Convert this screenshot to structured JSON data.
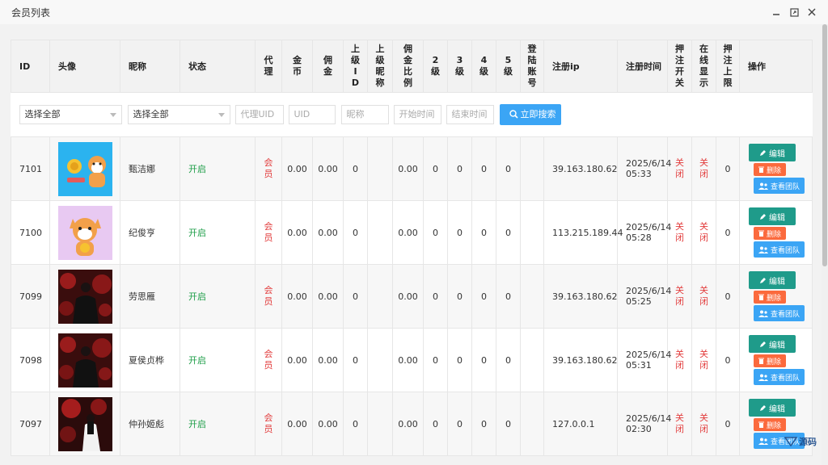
{
  "window": {
    "title": "会员列表"
  },
  "table": {
    "headers": {
      "id": "ID",
      "avatar": "头像",
      "nickname": "昵称",
      "status": "状态",
      "agent": "代理",
      "coins": "金币",
      "commission": "佣金",
      "parent_id": "上级ID",
      "parent_nick": "上级昵称",
      "comm_ratio": "佣金比例",
      "lv2": "2级",
      "lv3": "3级",
      "lv4": "4级",
      "lv5": "5级",
      "login_acct": "登陆账号",
      "reg_ip": "注册ip",
      "reg_time": "注册时间",
      "bet_switch": "押注开关",
      "online": "在线显示",
      "bet_limit": "押注上限",
      "ops": "操作"
    },
    "filters": {
      "select1": "选择全部",
      "select2": "选择全部",
      "agent_uid_placeholder": "代理UID",
      "uid_placeholder": "UID",
      "nickname_placeholder": "昵称",
      "start_placeholder": "开始时间",
      "end_placeholder": "结束时间",
      "search_label": "立即搜索"
    },
    "rows": [
      {
        "id": "7101",
        "avatar": "shiba-coins",
        "nickname": "甄洁娜",
        "status": "开启",
        "agent": "会员",
        "coins": "0.00",
        "commission": "0.00",
        "parent_id": "0",
        "parent_nick": "",
        "comm_ratio": "0.00",
        "lv2": "0",
        "lv3": "0",
        "lv4": "0",
        "lv5": "0",
        "login_acct": "",
        "reg_ip": "39.163.180.62",
        "reg_date": "2025/6/14",
        "reg_clock": "05:33",
        "bet_switch": "关闭",
        "online": "关闭",
        "bet_limit": "0"
      },
      {
        "id": "7100",
        "avatar": "shiba-purple",
        "nickname": "纪俊亨",
        "status": "开启",
        "agent": "会员",
        "coins": "0.00",
        "commission": "0.00",
        "parent_id": "0",
        "parent_nick": "",
        "comm_ratio": "0.00",
        "lv2": "0",
        "lv3": "0",
        "lv4": "0",
        "lv5": "0",
        "login_acct": "",
        "reg_ip": "113.215.189.44",
        "reg_date": "2025/6/14",
        "reg_clock": "05:28",
        "bet_switch": "关闭",
        "online": "关闭",
        "bet_limit": "0"
      },
      {
        "id": "7099",
        "avatar": "man-fireworks",
        "nickname": "劳思雁",
        "status": "开启",
        "agent": "会员",
        "coins": "0.00",
        "commission": "0.00",
        "parent_id": "0",
        "parent_nick": "",
        "comm_ratio": "0.00",
        "lv2": "0",
        "lv3": "0",
        "lv4": "0",
        "lv5": "0",
        "login_acct": "",
        "reg_ip": "39.163.180.62",
        "reg_date": "2025/6/14",
        "reg_clock": "05:25",
        "bet_switch": "关闭",
        "online": "关闭",
        "bet_limit": "0"
      },
      {
        "id": "7098",
        "avatar": "man-fireworks",
        "nickname": "夏侯贞桦",
        "status": "开启",
        "agent": "会员",
        "coins": "0.00",
        "commission": "0.00",
        "parent_id": "0",
        "parent_nick": "",
        "comm_ratio": "0.00",
        "lv2": "0",
        "lv3": "0",
        "lv4": "0",
        "lv5": "0",
        "login_acct": "",
        "reg_ip": "39.163.180.62",
        "reg_date": "2025/6/14",
        "reg_clock": "05:31",
        "bet_switch": "关闭",
        "online": "关闭",
        "bet_limit": "0"
      },
      {
        "id": "7097",
        "avatar": "woman-fireworks",
        "nickname": "仲孙姬彪",
        "status": "开启",
        "agent": "会员",
        "coins": "0.00",
        "commission": "0.00",
        "parent_id": "0",
        "parent_nick": "",
        "comm_ratio": "0.00",
        "lv2": "0",
        "lv3": "0",
        "lv4": "0",
        "lv5": "0",
        "login_acct": "",
        "reg_ip": "127.0.0.1",
        "reg_date": "2025/6/14",
        "reg_clock": "02:30",
        "bet_switch": "关闭",
        "online": "关闭",
        "bet_limit": "0"
      }
    ],
    "ops": {
      "edit": "编辑",
      "delete": "删除",
      "team": "查看团队"
    }
  },
  "watermark": "源码",
  "colors": {
    "edit": "#1f9b8a",
    "delete": "#fb6a3d",
    "team": "#3ba5f5",
    "on": "#1e9e48",
    "off": "#e23b3b"
  }
}
